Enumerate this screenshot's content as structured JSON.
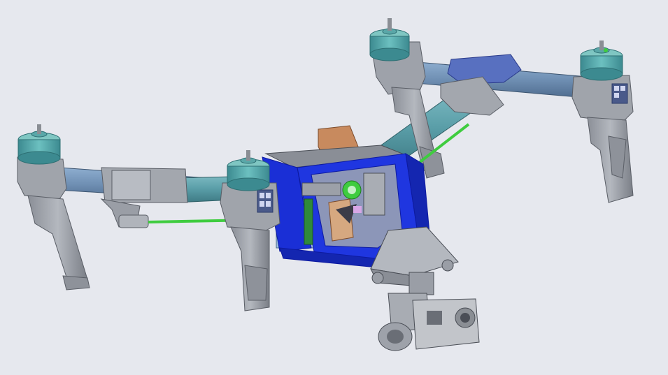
{
  "scene": {
    "background": "#e6e8ee",
    "colors": {
      "arm_tube": "#6f8fb3",
      "arm_tube_upper": "#5f9fa8",
      "motor": "#4a9ba0",
      "motor_top": "#7fc6c2",
      "bracket": "#9a9ea6",
      "bracket_dark": "#6c7078",
      "frame": "#1a2fd6",
      "frame_dark": "#0d1aa0",
      "linkage": "#3fcc3f",
      "battery": "#c88a5e",
      "camera": "#8a8c90",
      "pcb": "#2f8a3a"
    },
    "icons": [
      "motor-icon",
      "landing-leg-icon",
      "arm-tube-icon",
      "center-frame-icon",
      "gimbal-camera-icon",
      "linkage-rod-icon",
      "battery-icon"
    ]
  }
}
